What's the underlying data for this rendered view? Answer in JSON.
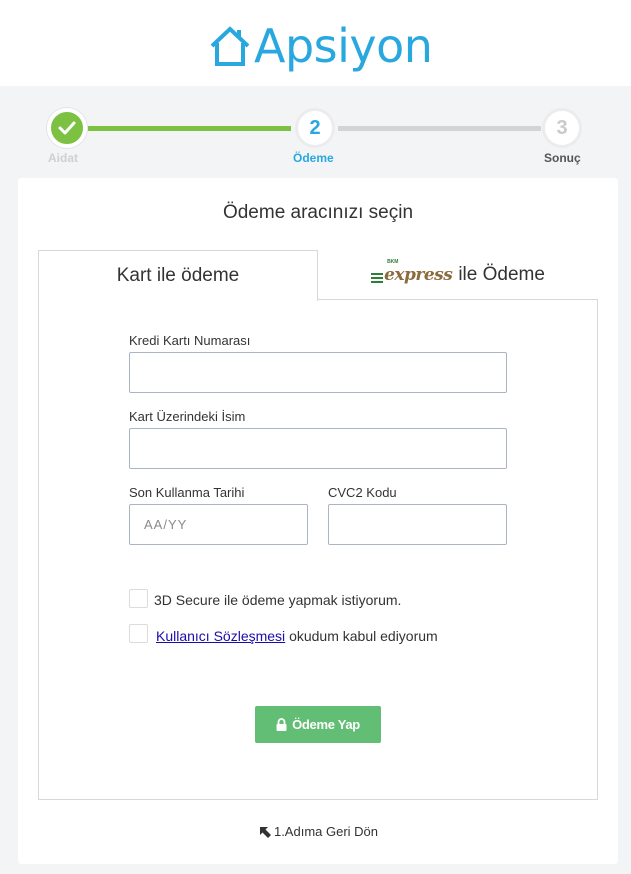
{
  "brand": {
    "name": "Apsiyon",
    "color": "#29a8df"
  },
  "stepper": {
    "steps": [
      {
        "number": "1",
        "label": "Aidat",
        "state": "completed",
        "icon": "check-icon"
      },
      {
        "number": "2",
        "label": "Ödeme",
        "state": "active"
      },
      {
        "number": "3",
        "label": "Sonuç",
        "state": "pending"
      }
    ],
    "colors": {
      "completed": "#7cc142",
      "active": "#29a8df",
      "pending": "#d3d4d6"
    }
  },
  "card": {
    "title": "Ödeme aracınızı seçin",
    "tabs": [
      {
        "label": "Kart ile ödeme",
        "active": true
      },
      {
        "logo_text": "express",
        "logo_sub": "BKM",
        "label": "ile Ödeme",
        "active": false
      }
    ]
  },
  "form": {
    "card_number": {
      "label": "Kredi Kartı Numarası",
      "value": "",
      "placeholder": ""
    },
    "card_name": {
      "label": "Kart Üzerindeki İsim",
      "value": "",
      "placeholder": ""
    },
    "expiry": {
      "label": "Son Kullanma Tarihi",
      "value": "",
      "placeholder": "AA/YY"
    },
    "cvc": {
      "label": "CVC2 Kodu",
      "value": "",
      "placeholder": ""
    },
    "secure_checkbox": {
      "label": "3D Secure ile ödeme yapmak istiyorum.",
      "checked": false
    },
    "agreement_checkbox": {
      "link_text": "Kullanıcı Sözleşmesi",
      "suffix": "okudum kabul ediyorum",
      "checked": false
    },
    "submit": {
      "label": "Ödeme Yap",
      "icon": "lock-icon",
      "color": "#62bd75"
    }
  },
  "back_link": {
    "label": "1.Adıma Geri Dön",
    "icon": "arrow-up-left-icon"
  }
}
